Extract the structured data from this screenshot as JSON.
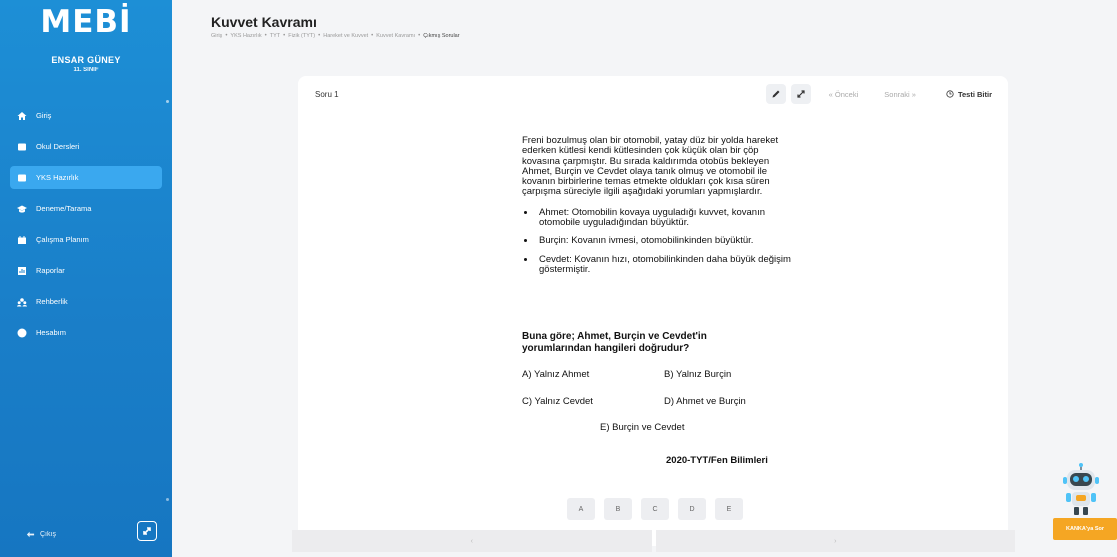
{
  "sidebar": {
    "logo": "MEBİ",
    "user_name": "ENSAR GÜNEY",
    "user_class": "11. SINIF",
    "items": [
      {
        "label": "Giriş",
        "icon": "home-icon"
      },
      {
        "label": "Okul Dersleri",
        "icon": "book-icon"
      },
      {
        "label": "YKS Hazırlık",
        "icon": "book-icon"
      },
      {
        "label": "Deneme/Tarama",
        "icon": "graduation-cap-icon"
      },
      {
        "label": "Çalışma Planım",
        "icon": "calendar-icon"
      },
      {
        "label": "Raporlar",
        "icon": "report-icon"
      },
      {
        "label": "Rehberlik",
        "icon": "users-icon"
      },
      {
        "label": "Hesabım",
        "icon": "user-icon"
      }
    ],
    "active_index": 2,
    "logout_label": "Çıkış"
  },
  "header": {
    "title": "Kuvvet Kavramı",
    "breadcrumb": [
      "Giriş",
      "YKS Hazırlık",
      "TYT",
      "Fizik (TYT)",
      "Hareket ve Kuvvet",
      "Kuvvet Kavramı",
      "Çıkmış Sorular"
    ]
  },
  "card": {
    "question_label": "Soru 1",
    "prev_label": "« Önceki",
    "next_label": "Sonraki »",
    "finish_label": "Testi Bitir"
  },
  "question": {
    "body": "Freni bozulmuş olan bir otomobil, yatay düz bir yolda hareket ederken kütlesi kendi kütlesinden çok küçük olan bir çöp kovasına çarpmıştır. Bu sırada kaldırımda otobüs bekleyen Ahmet, Burçin ve Cevdet olaya tanık olmuş ve otomobil ile kovanın birbirlerine temas etmekte oldukları çok kısa süren çarpışma süreciyle ilgili aşağıdaki yorumları yapmışlardır.",
    "bullets": [
      "Ahmet: Otomobilin kovaya uyguladığı kuvvet, kovanın otomobile uyguladığından büyüktür.",
      "Burçin: Kovanın ivmesi, otomobilinkinden büyüktür.",
      "Cevdet: Kovanın hızı, otomobilinkinden daha büyük değişim göstermiştir."
    ],
    "prompt": "Buna göre; Ahmet, Burçin ve Cevdet'in yorumlarından hangileri doğrudur?",
    "options": {
      "A": "A) Yalnız Ahmet",
      "B": "B) Yalnız Burçin",
      "C": "C) Yalnız Cevdet",
      "D": "D) Ahmet ve Burçin",
      "E": "E) Burçin ve Cevdet"
    },
    "source": "2020-TYT/Fen Bilimleri"
  },
  "answers": [
    "A",
    "B",
    "C",
    "D",
    "E"
  ],
  "pager": {
    "prev": "‹",
    "next": "›"
  },
  "assistant": {
    "button_label": "KANKA'ya Sor"
  },
  "colors": {
    "sidebar": "#1a84cc",
    "active_item": "#3aa8ef",
    "assistant_button": "#f5a623"
  }
}
